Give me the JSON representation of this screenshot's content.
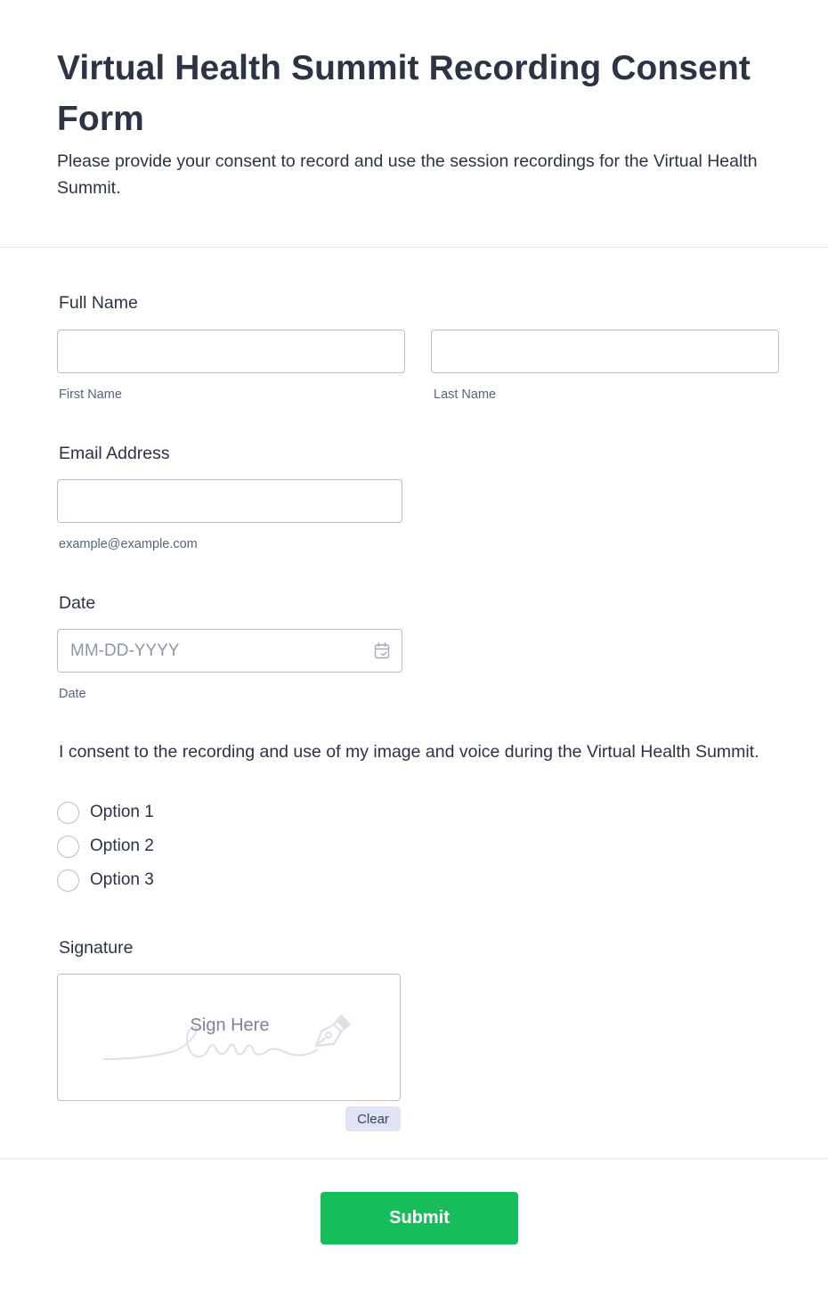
{
  "header": {
    "title": "Virtual Health Summit Recording Consent Form",
    "subtitle": "Please provide your consent to record and use the session recordings for the Virtual Health Summit."
  },
  "full_name": {
    "label": "Full Name",
    "first": {
      "value": "",
      "sublabel": "First Name"
    },
    "last": {
      "value": "",
      "sublabel": "Last Name"
    }
  },
  "email": {
    "label": "Email Address",
    "value": "",
    "sublabel": "example@example.com"
  },
  "date": {
    "label": "Date",
    "value": "",
    "placeholder": "MM-DD-YYYY",
    "sublabel": "Date",
    "icon": "calendar-icon"
  },
  "consent": {
    "question": "I consent to the recording and use of my image and voice during the Virtual Health Summit.",
    "options": [
      "Option 1",
      "Option 2",
      "Option 3"
    ]
  },
  "signature": {
    "label": "Signature",
    "placeholder": "Sign Here",
    "icon": "pen-nib-icon",
    "clear_label": "Clear"
  },
  "submit_label": "Submit",
  "colors": {
    "text": "#2c3345",
    "border": "#b8bdc9",
    "submit": "#18bd5b",
    "clear_bg": "#dfe3f3"
  }
}
